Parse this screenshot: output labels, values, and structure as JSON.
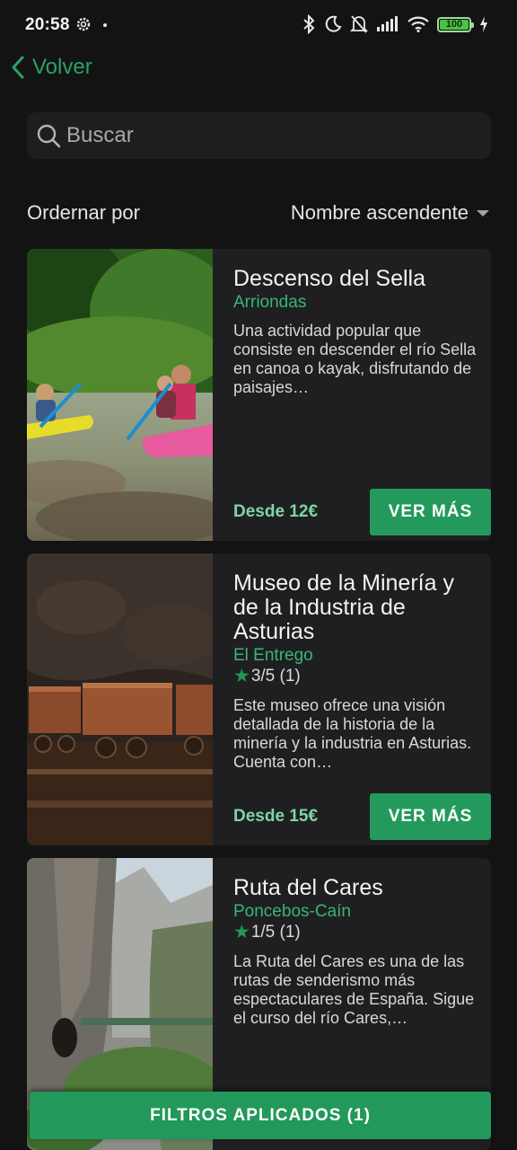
{
  "status_bar": {
    "time": "20:58",
    "battery": "100"
  },
  "nav": {
    "back_label": "Volver"
  },
  "search": {
    "placeholder": "Buscar",
    "value": ""
  },
  "sort": {
    "label": "Ordernar por",
    "value": "Nombre ascendente"
  },
  "cards": [
    {
      "title": "Descenso del Sella",
      "location": "Arriondas",
      "rating": "",
      "description": "Una actividad popular que consiste en descender el río Sella en canoa o kayak, disfrutando de paisajes…",
      "price": "Desde 12€",
      "button_label": "VER MÁS"
    },
    {
      "title": "Museo de la Minería y de la Industria de Asturias",
      "location": "El Entrego",
      "rating": "3/5 (1)",
      "description": "Este museo ofrece una visión detallada de la historia de la minería y la industria en Asturias. Cuenta con…",
      "price": "Desde 15€",
      "button_label": "VER MÁS"
    },
    {
      "title": "Ruta del Cares",
      "location": "Poncebos-Caín",
      "rating": "1/5 (1)",
      "description": "La Ruta del Cares es una de las rutas de senderismo más espectaculares de España. Sigue el curso del río Cares,…",
      "price": "",
      "button_label": ""
    }
  ],
  "filters_button": {
    "label": "FILTROS APLICADOS (1)"
  },
  "colors": {
    "accent": "#239a5b",
    "location": "#37b776",
    "price": "#7ed6a4",
    "background": "#131314",
    "card": "#1f1f21"
  },
  "icons": [
    "settings-gear-icon",
    "bluetooth-icon",
    "moon-icon",
    "bell-off-icon",
    "signal-icon",
    "wifi-icon",
    "battery-icon",
    "charging-icon",
    "back-chevron-icon",
    "search-icon",
    "dropdown-caret-icon",
    "star-icon"
  ]
}
